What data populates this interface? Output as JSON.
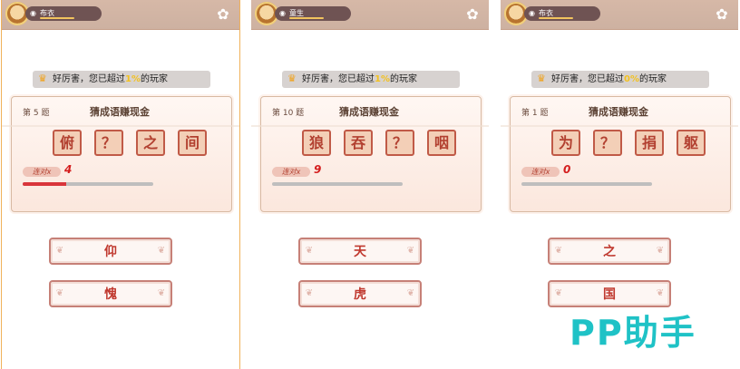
{
  "panels": [
    {
      "rank": "布衣",
      "notice": {
        "prefix": "好厉害，您已超过",
        "percent": "1%",
        "suffix": "的玩家"
      },
      "question_no": "第 5 题",
      "title": "猜成语赚现金",
      "tiles": [
        "俯",
        "？",
        "之",
        "间"
      ],
      "combo_label": "连对x",
      "combo_count": "4",
      "progress": 0.33,
      "answers": [
        "仰",
        "愧"
      ]
    },
    {
      "rank": "童生",
      "notice": {
        "prefix": "好厉害，您已超过",
        "percent": "1%",
        "suffix": "的玩家"
      },
      "question_no": "第 10 题",
      "title": "猜成语赚现金",
      "tiles": [
        "狼",
        "吞",
        "？",
        "咽"
      ],
      "combo_label": "连对x",
      "combo_count": "9",
      "progress": 0.0,
      "answers": [
        "天",
        "虎"
      ]
    },
    {
      "rank": "布衣",
      "notice": {
        "prefix": "好厉害，您已超过",
        "percent": "0%",
        "suffix": "的玩家"
      },
      "question_no": "第 1 题",
      "title": "猜成语赚现金",
      "tiles": [
        "为",
        "？",
        "捐",
        "躯"
      ],
      "combo_label": "连对x",
      "combo_count": "0",
      "progress": 0.0,
      "answers": [
        "之",
        "国"
      ]
    }
  ],
  "watermark": "PP助手",
  "colors": {
    "accent_red": "#d9353b",
    "tile_border": "#c05a47",
    "gold": "#f3c11f",
    "watermark": "#1fc2c6"
  },
  "icons": {
    "settings": "flower-gear-icon",
    "trophy": "trophy-icon",
    "rank": "eye-icon"
  }
}
